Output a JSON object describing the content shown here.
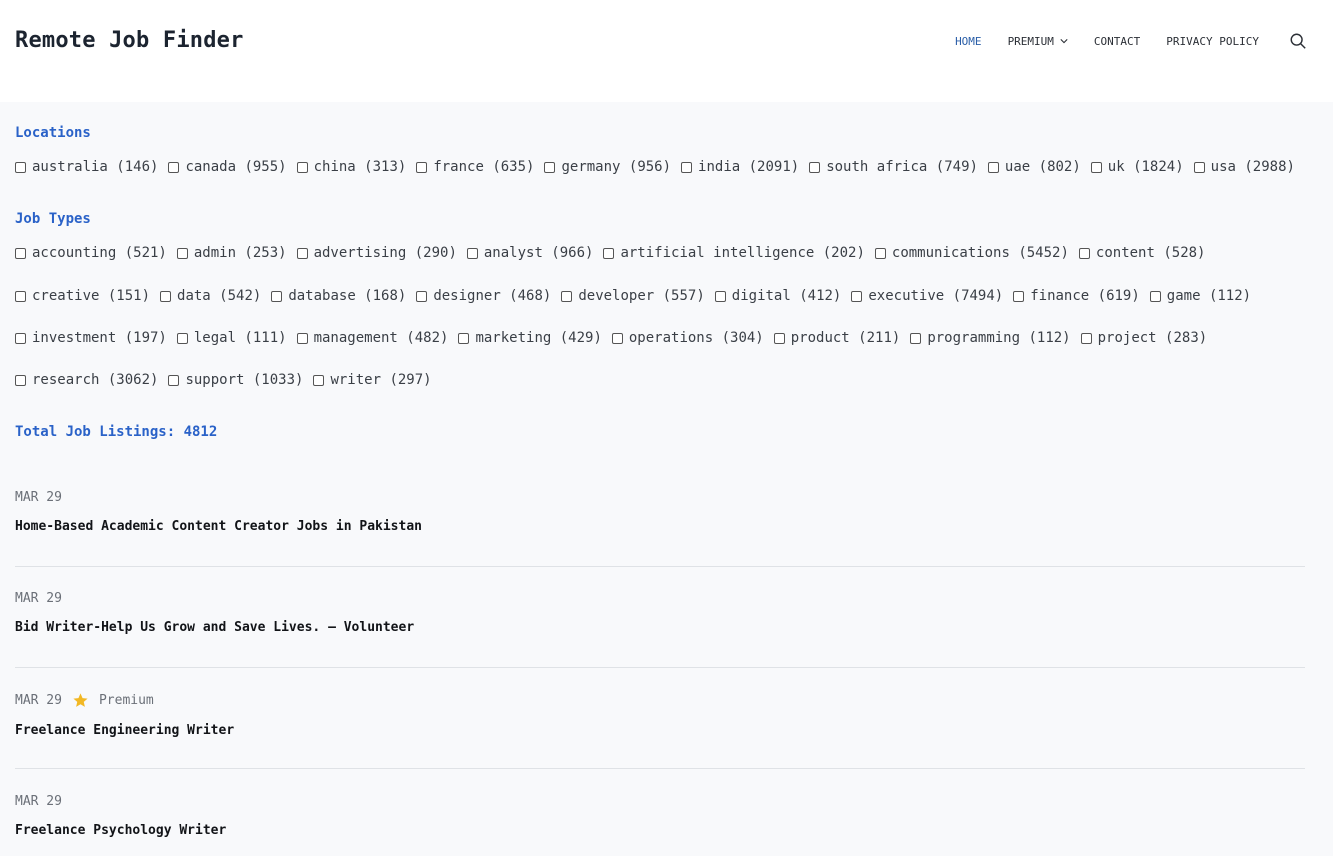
{
  "site": {
    "title": "Remote Job Finder"
  },
  "nav": {
    "items": [
      {
        "label": "HOME",
        "active": true
      },
      {
        "label": "PREMIUM",
        "has_dropdown": true
      },
      {
        "label": "CONTACT"
      },
      {
        "label": "PRIVACY POLICY"
      }
    ],
    "search_icon": "search-icon"
  },
  "filters": {
    "locations_heading": "Locations",
    "locations": [
      "australia (146)",
      "canada (955)",
      "china (313)",
      "france (635)",
      "germany (956)",
      "india (2091)",
      "south africa (749)",
      "uae (802)",
      "uk (1824)",
      "usa (2988)"
    ],
    "job_types_heading": "Job Types",
    "job_type_rows": [
      [
        "accounting (521)",
        "admin (253)",
        "advertising (290)",
        "analyst (966)",
        "artificial intelligence (202)",
        "communications (5452)",
        "content (528)"
      ],
      [
        "creative (151)",
        "data (542)",
        "database (168)",
        "designer (468)",
        "developer (557)",
        "digital (412)",
        "executive (7494)",
        "finance (619)",
        "game (112)"
      ],
      [
        "investment (197)",
        "legal (111)",
        "management (482)",
        "marketing (429)",
        "operations (304)",
        "product (211)",
        "programming (112)",
        "project (283)"
      ],
      [
        "research (3062)",
        "support (1033)",
        "writer (297)"
      ]
    ]
  },
  "total_label": "Total Job Listings: 4812",
  "jobs": [
    {
      "date": "MAR 29",
      "premium": false,
      "title": "Home-Based Academic Content Creator Jobs in Pakistan"
    },
    {
      "date": "MAR 29",
      "premium": false,
      "title": "Bid Writer-Help Us Grow and Save Lives. – Volunteer"
    },
    {
      "date": "MAR 29",
      "premium": true,
      "premium_label": "Premium",
      "title": "Freelance Engineering Writer"
    },
    {
      "date": "MAR 29",
      "premium": false,
      "title": "Freelance Psychology Writer"
    }
  ],
  "colors": {
    "accent": "#2a62c8",
    "nav_active": "#2a5ea8",
    "star": "#f2b824",
    "background": "#f8f9fb"
  }
}
